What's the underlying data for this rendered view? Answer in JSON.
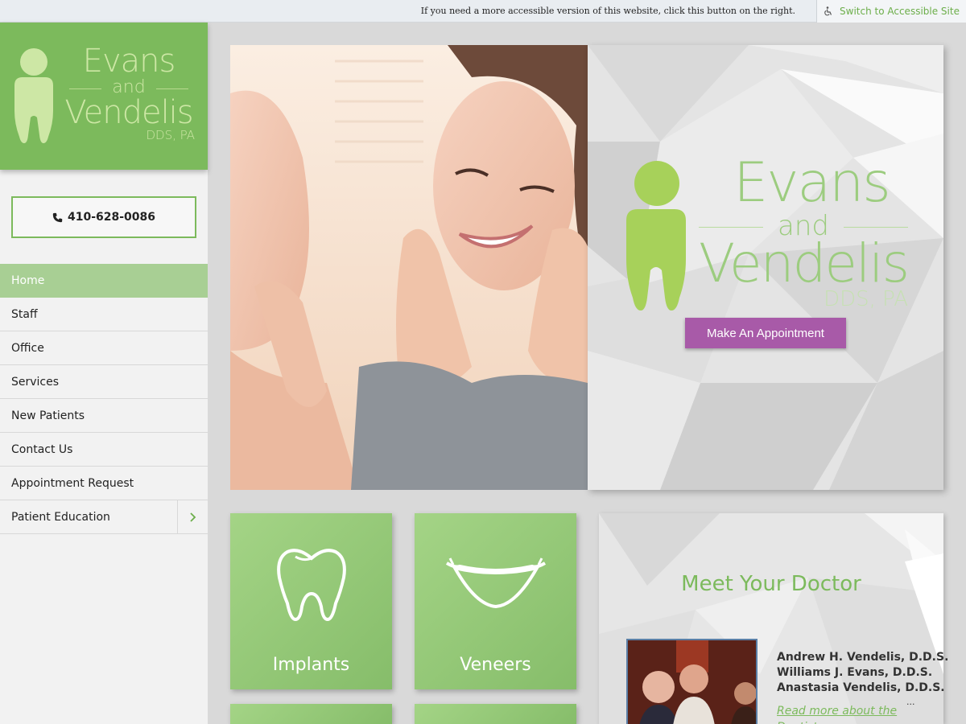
{
  "topbar": {
    "message": "If you need a more accessible version of this website, click this button on the right.",
    "accessible_button": "Switch to Accessible Site"
  },
  "logo": {
    "line1": "Evans",
    "line2": "and",
    "line3": "Vendelis",
    "line4": "DDS, PA"
  },
  "phone": {
    "label": "410-628-0086"
  },
  "nav": {
    "items": [
      {
        "label": "Home"
      },
      {
        "label": "Staff"
      },
      {
        "label": "Office"
      },
      {
        "label": "Services"
      },
      {
        "label": "New Patients"
      },
      {
        "label": "Contact Us"
      },
      {
        "label": "Appointment Request"
      },
      {
        "label": "Patient Education"
      }
    ]
  },
  "hero": {
    "appointment_button": "Make An Appointment"
  },
  "tiles": {
    "implants": "Implants",
    "veneers": "Veneers"
  },
  "doctor": {
    "title": "Meet Your Doctor",
    "names": [
      "Andrew H. Vendelis, D.D.S.",
      "Williams J. Evans, D.D.S.",
      "Anastasia Vendelis, D.D.S."
    ],
    "read_more": "Read more about the Dentists",
    "ellipsis": "..."
  },
  "colors": {
    "brand_green": "#7cba5c",
    "appointment_purple": "#a85aa8",
    "nav_active": "#a8cf94"
  }
}
